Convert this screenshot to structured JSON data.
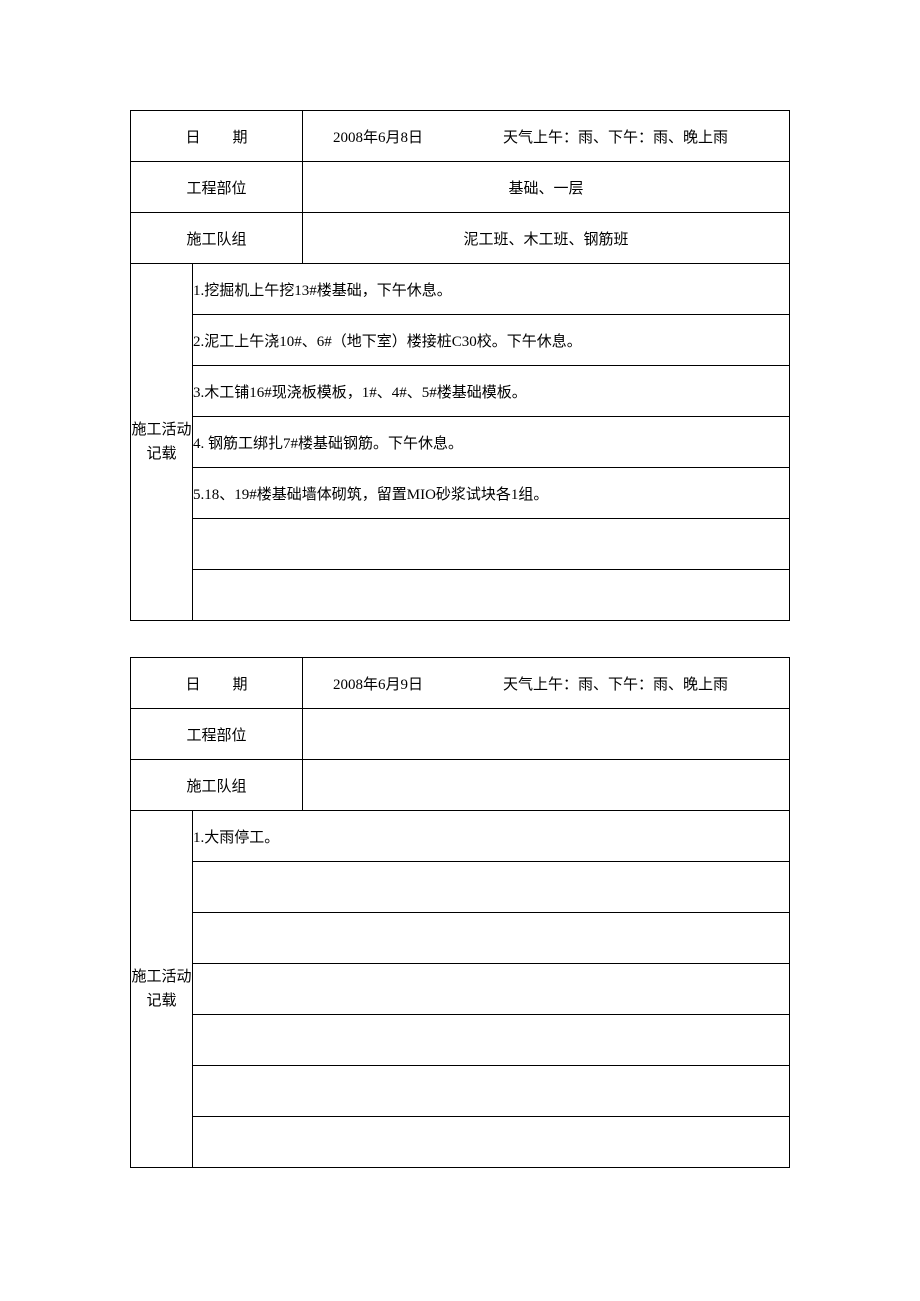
{
  "labels": {
    "date": "日　　期",
    "project_part": "工程部位",
    "team": "施工队组",
    "activity": "施工活动记载"
  },
  "entries": [
    {
      "date_value": "2008年6月8日",
      "weather": "天气上午：雨、下午：雨、晚上雨",
      "project_part": "基础、一层",
      "team": "泥工班、木工班、钢筋班",
      "activities": [
        "1.挖掘机上午挖13#楼基础，下午休息。",
        "2.泥工上午浇10#、6#（地下室）楼接桩C30校。下午休息。",
        "3.木工铺16#现浇板模板，1#、4#、5#楼基础模板。",
        "4. 钢筋工绑扎7#楼基础钢筋。下午休息。",
        "5.18、19#楼基础墙体砌筑，留置MIO砂浆试块各1组。",
        "",
        ""
      ]
    },
    {
      "date_value": "2008年6月9日",
      "weather": "天气上午：雨、下午：雨、晚上雨",
      "project_part": "",
      "team": "",
      "activities": [
        "1.大雨停工。",
        "",
        "",
        "",
        "",
        "",
        ""
      ]
    }
  ]
}
